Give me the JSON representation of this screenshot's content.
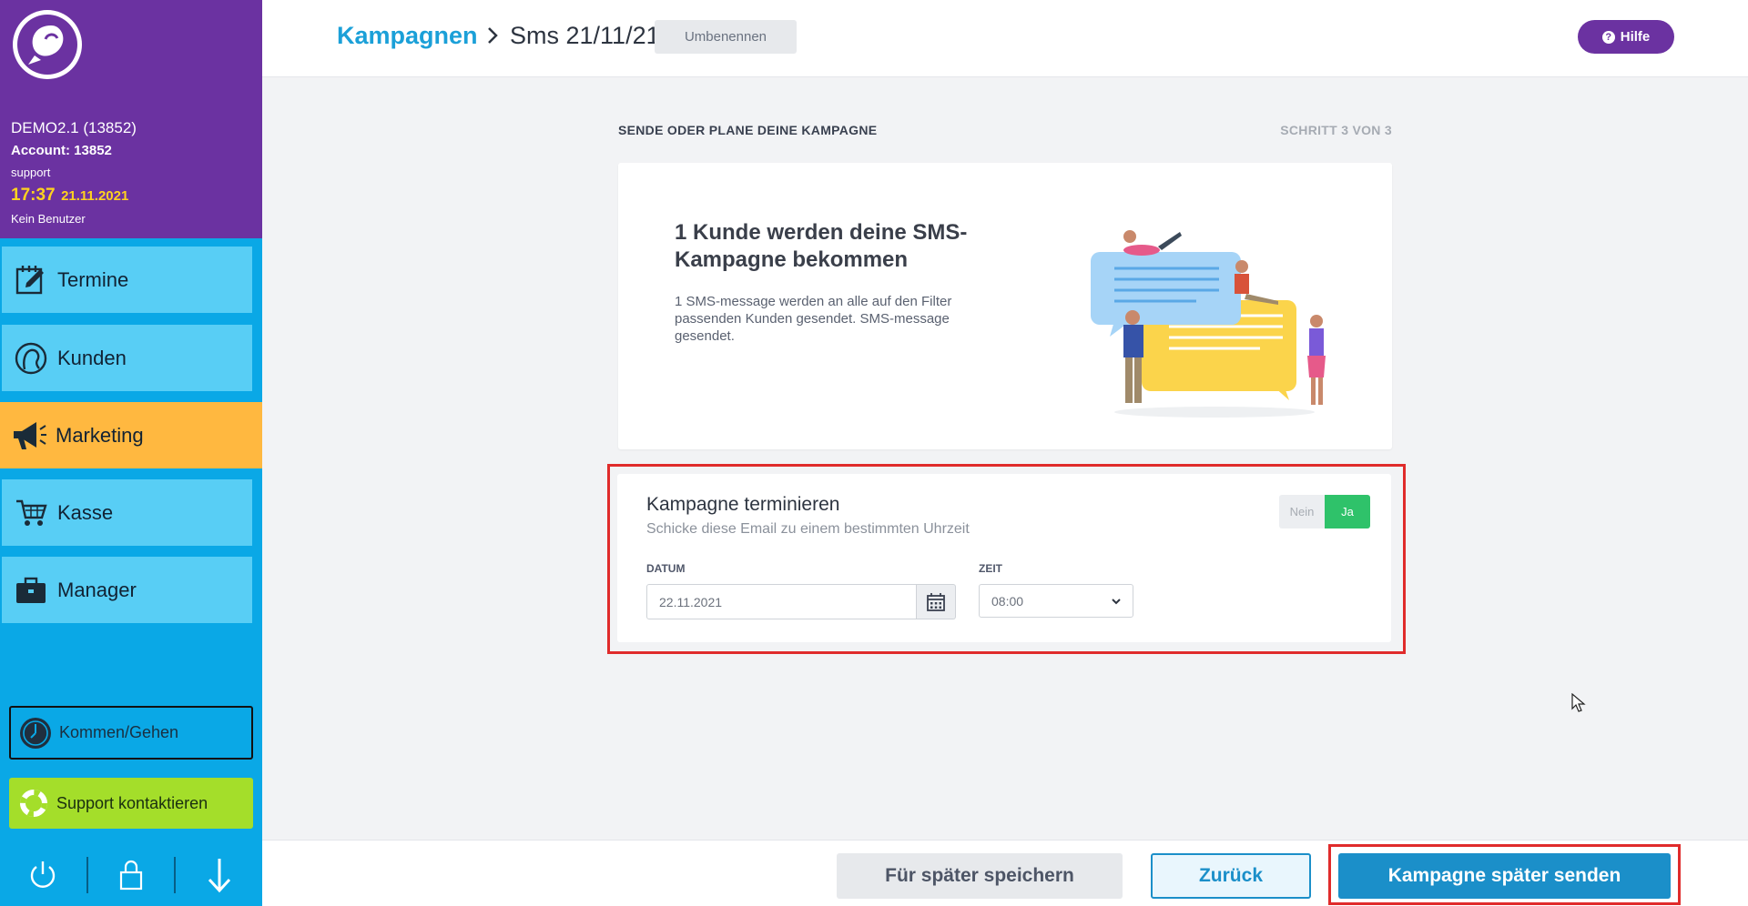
{
  "sidebar": {
    "account": {
      "name": "DEMO2.1 (13852)",
      "account_line": "Account: 13852",
      "role": "support",
      "time": "17:37",
      "date": "21.11.2021",
      "user_status": "Kein Benutzer"
    },
    "nav": [
      {
        "label": "Termine",
        "icon": "calendar-edit-icon"
      },
      {
        "label": "Kunden",
        "icon": "customer-head-icon"
      },
      {
        "label": "Marketing",
        "icon": "megaphone-icon",
        "active": true
      },
      {
        "label": "Kasse",
        "icon": "shopping-cart-icon"
      },
      {
        "label": "Manager",
        "icon": "briefcase-icon"
      }
    ],
    "kommen_label": "Kommen/Gehen",
    "support_label": "Support kontaktieren",
    "footer_icons": [
      "power-icon",
      "lock-icon",
      "arrow-down-icon"
    ]
  },
  "topbar": {
    "breadcrumb_link": "Kampagnen",
    "breadcrumb_current": "Sms 21/11/21",
    "rename_label": "Umbenennen",
    "help_label": "Hilfe"
  },
  "main": {
    "section_title": "SENDE ODER PLANE DEINE KAMPAGNE",
    "step": "SCHRITT 3 VON 3",
    "info": {
      "heading": "1 Kunde werden deine SMS-Kampagne bekommen",
      "text": "1 SMS-message werden an alle auf den Filter passenden Kunden gesendet. SMS-message gesendet."
    },
    "schedule": {
      "title": "Kampagne terminieren",
      "subtitle": "Schicke diese Email zu einem bestimmten Uhrzeit",
      "toggle_no": "Nein",
      "toggle_yes": "Ja",
      "toggle_value": "Ja",
      "date_label": "DATUM",
      "date_value": "22.11.2021",
      "time_label": "ZEIT",
      "time_value": "08:00"
    }
  },
  "footer": {
    "save_label": "Für später speichern",
    "back_label": "Zurück",
    "send_label": "Kampagne später senden"
  },
  "colors": {
    "sidebar_blue": "#0aa8e6",
    "nav_blue": "#58cef5",
    "brand_purple": "#6b32a1",
    "active_orange": "#ffb840",
    "link_blue": "#1ba0d8",
    "primary_button": "#1b8fc9",
    "toggle_green": "#2fc26a",
    "support_green": "#a4de2a",
    "highlight_red": "#e02b2b"
  }
}
